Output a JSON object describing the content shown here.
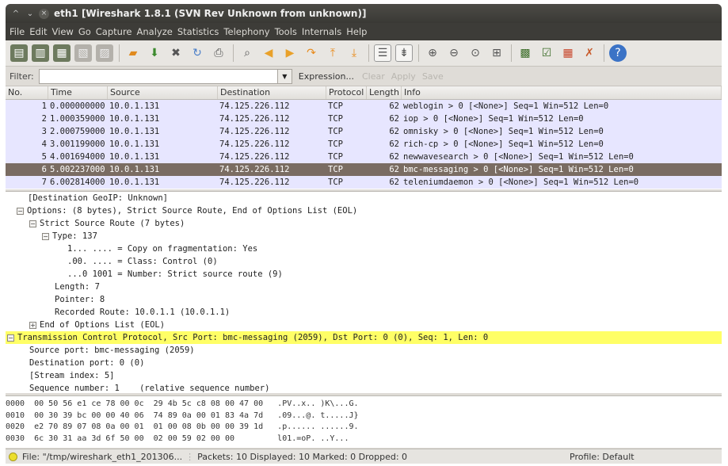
{
  "window": {
    "title": "eth1   [Wireshark 1.8.1  (SVN Rev Unknown from unknown)]"
  },
  "menu": [
    "File",
    "Edit",
    "View",
    "Go",
    "Capture",
    "Analyze",
    "Statistics",
    "Telephony",
    "Tools",
    "Internals",
    "Help"
  ],
  "filter": {
    "label": "Filter:",
    "value": "",
    "expression": "Expression...",
    "clear": "Clear",
    "apply": "Apply",
    "save": "Save"
  },
  "columns": [
    "No.",
    "Time",
    "Source",
    "Destination",
    "Protocol",
    "Length",
    "Info"
  ],
  "packets": [
    {
      "no": "1",
      "time": "0.000000000",
      "src": "10.0.1.131",
      "dst": "74.125.226.112",
      "proto": "TCP",
      "len": "62",
      "info": "weblogin > 0 [<None>] Seq=1 Win=512 Len=0"
    },
    {
      "no": "2",
      "time": "1.000359000",
      "src": "10.0.1.131",
      "dst": "74.125.226.112",
      "proto": "TCP",
      "len": "62",
      "info": "iop > 0 [<None>] Seq=1 Win=512 Len=0"
    },
    {
      "no": "3",
      "time": "2.000759000",
      "src": "10.0.1.131",
      "dst": "74.125.226.112",
      "proto": "TCP",
      "len": "62",
      "info": "omnisky > 0 [<None>] Seq=1 Win=512 Len=0"
    },
    {
      "no": "4",
      "time": "3.001199000",
      "src": "10.0.1.131",
      "dst": "74.125.226.112",
      "proto": "TCP",
      "len": "62",
      "info": "rich-cp > 0 [<None>] Seq=1 Win=512 Len=0"
    },
    {
      "no": "5",
      "time": "4.001694000",
      "src": "10.0.1.131",
      "dst": "74.125.226.112",
      "proto": "TCP",
      "len": "62",
      "info": "newwavesearch > 0 [<None>] Seq=1 Win=512 Len=0"
    },
    {
      "no": "6",
      "time": "5.002237000",
      "src": "10.0.1.131",
      "dst": "74.125.226.112",
      "proto": "TCP",
      "len": "62",
      "info": "bmc-messaging > 0 [<None>] Seq=1 Win=512 Len=0"
    },
    {
      "no": "7",
      "time": "6.002814000",
      "src": "10.0.1.131",
      "dst": "74.125.226.112",
      "proto": "TCP",
      "len": "62",
      "info": "teleniumdaemon > 0 [<None>] Seq=1 Win=512 Len=0"
    }
  ],
  "selected_packet": "6",
  "details": [
    {
      "indent": 28,
      "toggle": "",
      "text": "[Destination GeoIP: Unknown]",
      "hl": false
    },
    {
      "indent": 14,
      "toggle": "−",
      "text": "Options: (8 bytes), Strict Source Route, End of Options List (EOL)",
      "hl": false
    },
    {
      "indent": 30,
      "toggle": "−",
      "text": "Strict Source Route (7 bytes)",
      "hl": false
    },
    {
      "indent": 46,
      "toggle": "−",
      "text": "Type: 137",
      "hl": false
    },
    {
      "indent": 78,
      "toggle": "",
      "text": "1... .... = Copy on fragmentation: Yes",
      "hl": false
    },
    {
      "indent": 78,
      "toggle": "",
      "text": ".00. .... = Class: Control (0)",
      "hl": false
    },
    {
      "indent": 78,
      "toggle": "",
      "text": "...0 1001 = Number: Strict source route (9)",
      "hl": false
    },
    {
      "indent": 62,
      "toggle": "",
      "text": "Length: 7",
      "hl": false
    },
    {
      "indent": 62,
      "toggle": "",
      "text": "Pointer: 8",
      "hl": false
    },
    {
      "indent": 62,
      "toggle": "",
      "text": "Recorded Route: 10.0.1.1 (10.0.1.1)",
      "hl": false
    },
    {
      "indent": 30,
      "toggle": "+",
      "text": "End of Options List (EOL)",
      "hl": false
    },
    {
      "indent": 2,
      "toggle": "−",
      "text": "Transmission Control Protocol, Src Port: bmc-messaging (2059), Dst Port: 0 (0), Seq: 1, Len: 0",
      "hl": true
    },
    {
      "indent": 30,
      "toggle": "",
      "text": "Source port: bmc-messaging (2059)",
      "hl": false
    },
    {
      "indent": 30,
      "toggle": "",
      "text": "Destination port: 0 (0)",
      "hl": false
    },
    {
      "indent": 30,
      "toggle": "",
      "text": "[Stream index: 5]",
      "hl": false
    },
    {
      "indent": 30,
      "toggle": "",
      "text": "Sequence number: 1    (relative sequence number)",
      "hl": false
    }
  ],
  "hex": [
    "0000  00 50 56 e1 ce 78 00 0c  29 4b 5c c8 08 00 47 00   .PV..x.. )K\\...G.",
    "0010  00 30 39 bc 00 00 40 06  74 89 0a 00 01 83 4a 7d   .09...@. t.....J}",
    "0020  e2 70 89 07 08 0a 00 01  01 00 08 0b 00 00 39 1d   .p...... ......9.",
    "0030  6c 30 31 aa 3d 6f 50 00  02 00 59 02 00 00         l01.=oP. ..Y..."
  ],
  "status": {
    "file": "File: \"/tmp/wireshark_eth1_201306...",
    "packets": "Packets: 10 Displayed: 10 Marked: 0 Dropped: 0",
    "profile": "Profile: Default"
  },
  "colors": {
    "row_bg": "#e7e6ff",
    "selected_bg": "#7a6c62",
    "highlight": "#ffff66"
  }
}
